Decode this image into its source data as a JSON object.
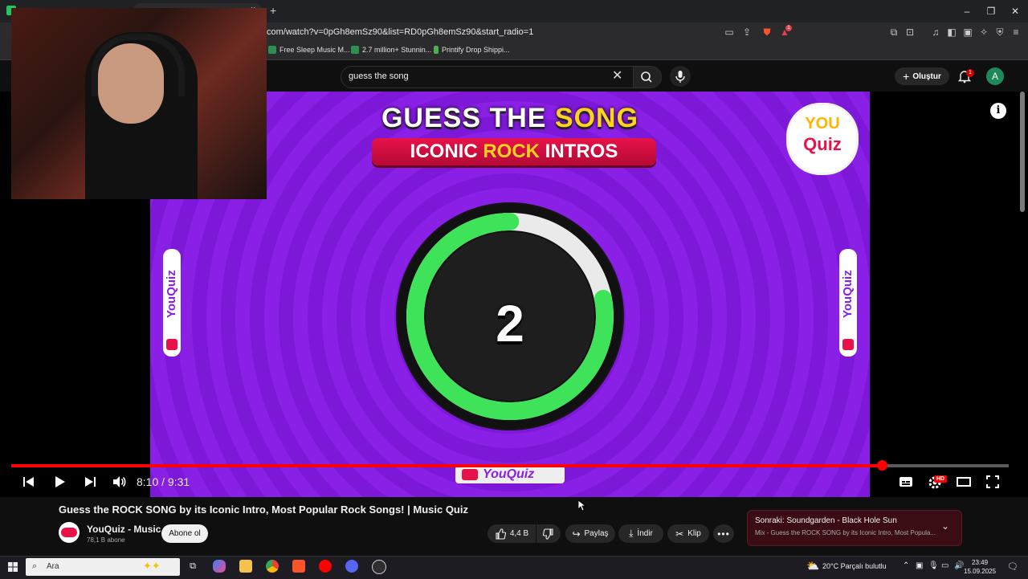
{
  "browser": {
    "url": "com/watch?v=0pGh8emSz90&list=RD0pGh8emSz90&start_radio=1",
    "bookmarks": [
      {
        "label": "Free Sleep Music M...",
        "color": "#2f8f4e"
      },
      {
        "label": "2.7 million+ Stunnin...",
        "color": "#2f8f4e"
      },
      {
        "label": "Printify Drop Shippi...",
        "color": "#4caf50"
      }
    ],
    "extension_badge": "1"
  },
  "youtube_header": {
    "search_value": "guess the song",
    "create_label": "Oluştur",
    "notif_count": "1",
    "avatar_letter": "A"
  },
  "video": {
    "title_line1_a": "GUESS THE ",
    "title_line1_b": "SONG",
    "banner_a": "ICONIC ",
    "banner_b": "ROCK",
    "banner_c": " INTROS",
    "logo_top": "YOU",
    "logo_bottom": "Quiz",
    "side_brand": "YouQuiz",
    "countdown": "2",
    "ring_progress": 0.78,
    "bottom_brand": "YouQuiz"
  },
  "player": {
    "time_current": "8:10",
    "time_sep": " / ",
    "time_total": "9:31",
    "progress": 0.8725,
    "hd_badge": "HD"
  },
  "below": {
    "title": "Guess the ROCK SONG by its Iconic Intro, Most Popular Rock Songs! | Music Quiz",
    "channel_name": "YouQuiz - Music",
    "channel_subs": "78,1 B abone",
    "subscribe_label": "Abone ol",
    "like_count": "4,4 B",
    "share_label": "Paylaş",
    "download_label": "İndir",
    "clip_label": "Klip",
    "next_label": "Sonraki: Soundgarden - Black Hole Sun",
    "next_sub": "Mix - Guess the ROCK SONG by its Iconic Intro, Most Popula..."
  },
  "taskbar": {
    "search_placeholder": "Ara",
    "weather_temp": "20°C",
    "weather_desc": "Parçalı bulutlu",
    "time": "23:49",
    "date": "15.09.2025"
  },
  "colors": {
    "accent_red": "#ff0000",
    "video_purple": "#8a1fe6",
    "ring_green": "#3ee35a",
    "title_yellow": "#ffd21f"
  }
}
